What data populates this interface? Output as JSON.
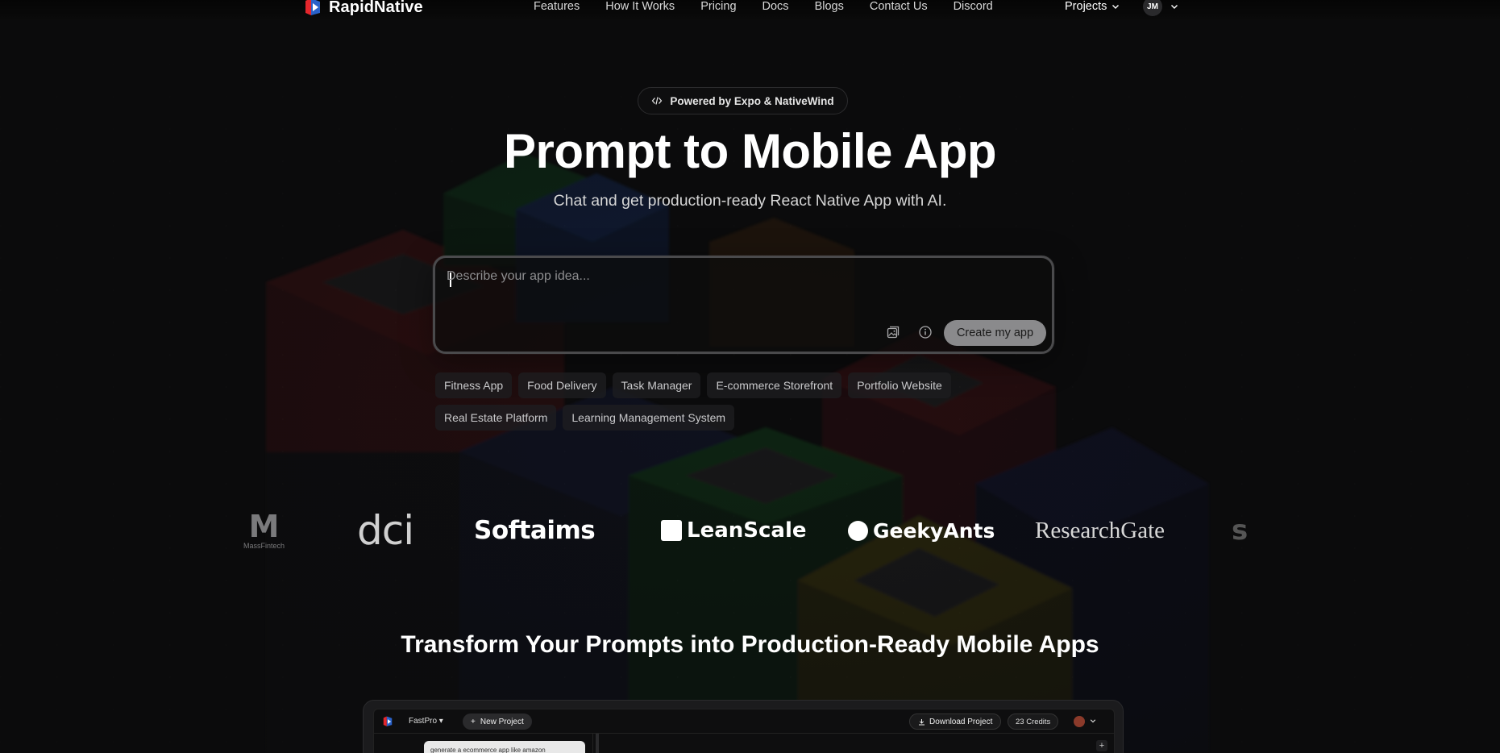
{
  "brand": {
    "name": "RapidNative"
  },
  "nav": {
    "links": [
      "Features",
      "How It Works",
      "Pricing",
      "Docs",
      "Blogs",
      "Contact Us",
      "Discord"
    ],
    "projects_label": "Projects",
    "avatar_initials": "JM"
  },
  "hero": {
    "badge": "Powered by Expo & NativeWind",
    "title": "Prompt to Mobile App",
    "subtitle": "Chat and get production-ready React Native App with AI."
  },
  "prompt": {
    "placeholder": "Describe your app idea...",
    "value": "",
    "create_label": "Create my app",
    "icons": [
      "image-upload-icon",
      "info-icon"
    ]
  },
  "suggestions": [
    "Fitness App",
    "Food Delivery",
    "Task Manager",
    "E-commerce Storefront",
    "Portfolio Website",
    "Real Estate Platform",
    "Learning Management System"
  ],
  "customer_logos": {
    "massfintech": {
      "mark": "M",
      "text": "MassFintech"
    },
    "dci": "dci",
    "softaims": "Softaims",
    "leanscale": "LeanScale",
    "geekyants": "GeekyAnts",
    "researchgate": "ResearchGate",
    "partial": "s"
  },
  "section": {
    "title": "Transform Your Prompts into Production-Ready Mobile Apps"
  },
  "preview": {
    "project_name": "FastPro",
    "new_project_label": "New Project",
    "download_label": "Download Project",
    "credits": "23 Credits",
    "message": "generate a ecommerce app like amazon"
  },
  "colors": {
    "background": "#0b0b0c",
    "accent_red": "#e4262c",
    "accent_blue": "#2d6cdf",
    "button_bg": "#8a8a8c"
  }
}
